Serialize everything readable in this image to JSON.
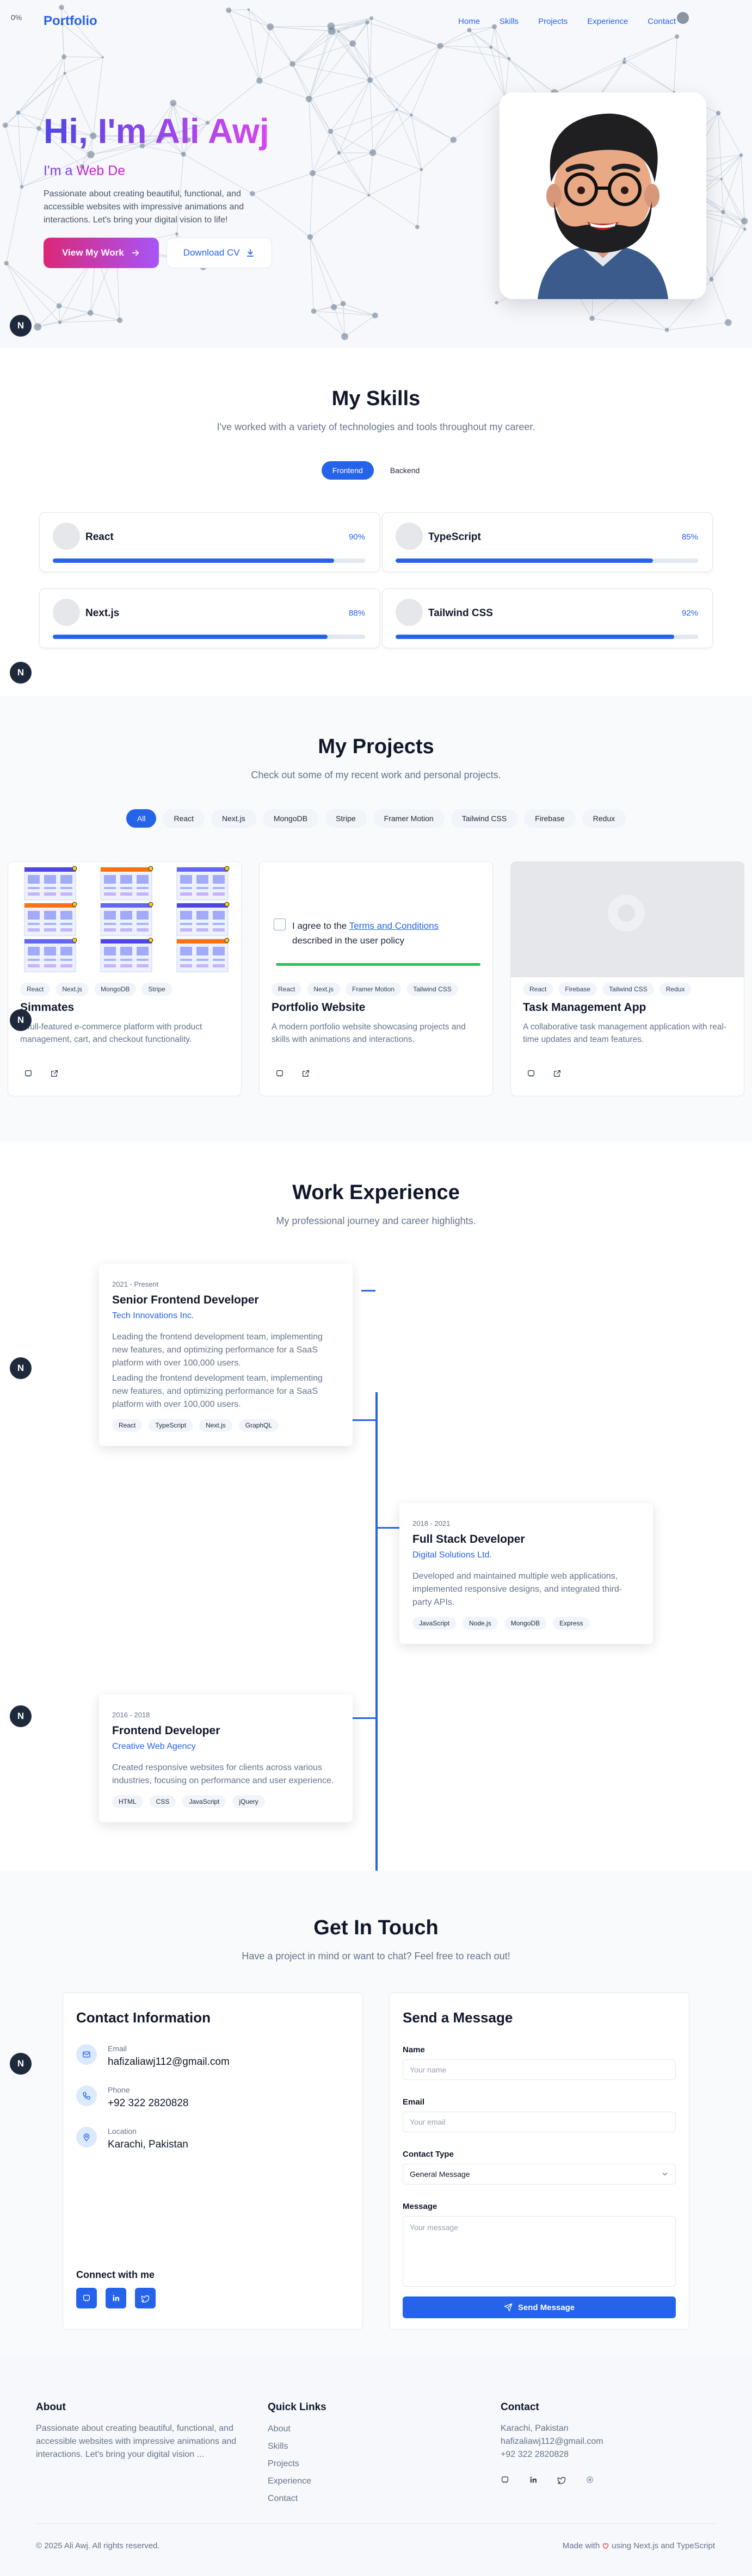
{
  "colors": {
    "accent": "#2563eb",
    "gradient_start": "#4f46e5",
    "gradient_end": "#d946ef",
    "button_pink": "#db2777",
    "heart": "#ef4444"
  },
  "nav": {
    "corner_glyph": "0%",
    "brand": "Portfolio",
    "links": [
      "Home",
      "Skills",
      "Projects",
      "Experience",
      "Contact"
    ]
  },
  "hero": {
    "title": "Hi, I'm Ali Awj",
    "role_prefix": "I'm a ",
    "role_word": "Web De",
    "description": "Passionate about creating beautiful, functional, and accessible websites with impressive animations and interactions. Let's bring your digital vision to life!",
    "primary_button": "View My Work",
    "secondary_button": "Download CV"
  },
  "badge_letter": "N",
  "skills": {
    "title": "My Skills",
    "subtitle": "I've worked with a variety of technologies and tools throughout my career.",
    "tabs": [
      "Frontend",
      "Backend"
    ],
    "active_tab": "Frontend",
    "items": [
      {
        "name": "React",
        "level": 90,
        "level_label": "90%"
      },
      {
        "name": "TypeScript",
        "level": 85,
        "level_label": "85%"
      },
      {
        "name": "Next.js",
        "level": 88,
        "level_label": "88%"
      },
      {
        "name": "Tailwind CSS",
        "level": 92,
        "level_label": "92%"
      }
    ]
  },
  "projects": {
    "title": "My Projects",
    "subtitle": "Check out some of my recent work and personal projects.",
    "filters": [
      "All",
      "React",
      "Next.js",
      "MongoDB",
      "Stripe",
      "Framer Motion",
      "Tailwind CSS",
      "Firebase",
      "Redux"
    ],
    "active_filter": "All",
    "preview_checkbox_text_before": "I agree to the ",
    "preview_checkbox_link": "Terms and Conditions",
    "preview_checkbox_text_after": " described in the user policy",
    "items": [
      {
        "name": "Simmates",
        "tags": [
          "React",
          "Next.js",
          "MongoDB",
          "Stripe"
        ],
        "description": "A full-featured e-commerce platform with product management, cart, and checkout functionality."
      },
      {
        "name": "Portfolio Website",
        "tags": [
          "React",
          "Next.js",
          "Framer Motion",
          "Tailwind CSS"
        ],
        "description": "A modern portfolio website showcasing projects and skills with animations and interactions."
      },
      {
        "name": "Task Management App",
        "tags": [
          "React",
          "Firebase",
          "Tailwind CSS",
          "Redux"
        ],
        "description": "A collaborative task management application with real-time updates and team features."
      }
    ]
  },
  "experience": {
    "title": "Work Experience",
    "subtitle": "My professional journey and career highlights.",
    "items": [
      {
        "date": "2021 - Present",
        "role": "Senior Frontend Developer",
        "company": "Tech Innovations Inc.",
        "descriptions": [
          "Leading the frontend development team, implementing new features, and optimizing performance for a SaaS platform with over 100,000 users.",
          "Leading the frontend development team, implementing new features, and optimizing performance for a SaaS platform with over 100,000 users."
        ],
        "tags": [
          "React",
          "TypeScript",
          "Next.js",
          "GraphQL"
        ]
      },
      {
        "date": "2018 - 2021",
        "role": "Full Stack Developer",
        "company": "Digital Solutions Ltd.",
        "descriptions": [
          "Developed and maintained multiple web applications, implemented responsive designs, and integrated third-party APIs."
        ],
        "tags": [
          "JavaScript",
          "Node.js",
          "MongoDB",
          "Express"
        ]
      },
      {
        "date": "2016 - 2018",
        "role": "Frontend Developer",
        "company": "Creative Web Agency",
        "descriptions": [
          "Created responsive websites for clients across various industries, focusing on performance and user experience."
        ],
        "tags": [
          "HTML",
          "CSS",
          "JavaScript",
          "jQuery"
        ]
      }
    ]
  },
  "contact": {
    "title": "Get In Touch",
    "subtitle": "Have a project in mind or want to chat? Feel free to reach out!",
    "info_title": "Contact Information",
    "email_label": "Email",
    "email": "hafizaliawj112@gmail.com",
    "phone_label": "Phone",
    "phone": "+92 322 2820828",
    "location_label": "Location",
    "location": "Karachi, Pakistan",
    "connect_title": "Connect with me",
    "form_title": "Send a Message",
    "name_label": "Name",
    "name_placeholder": "Your name",
    "email_field_label": "Email",
    "email_placeholder": "Your email",
    "type_label": "Contact Type",
    "type_value": "General Message",
    "message_label": "Message",
    "message_placeholder": "Your message",
    "submit": "Send Message"
  },
  "footer": {
    "about_title": "About",
    "about_text": "Passionate about creating beautiful, functional, and accessible websites with impressive animations and interactions. Let's bring your digital vision ...",
    "links_title": "Quick Links",
    "links": [
      "About",
      "Skills",
      "Projects",
      "Experience",
      "Contact"
    ],
    "contact_title": "Contact",
    "location": "Karachi, Pakistan",
    "email": "hafizaliawj112@gmail.com",
    "phone": "+92 322 2820828",
    "copyright": "© 2025 Ali Awj. All rights reserved.",
    "made_prefix": "Made with",
    "made_suffix": "using Next.js and TypeScript"
  }
}
